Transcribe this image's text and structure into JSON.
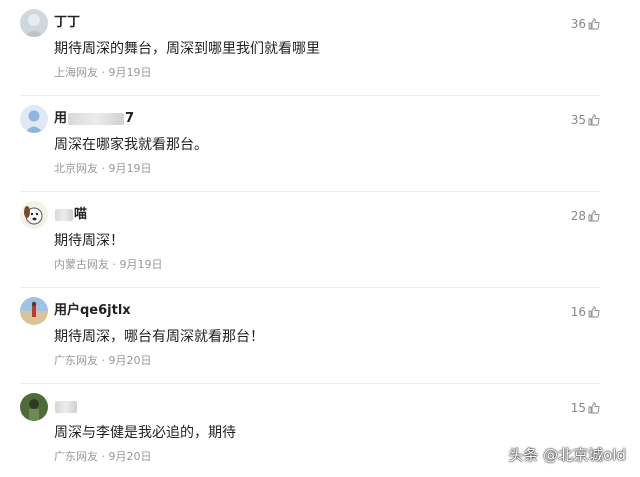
{
  "comments": [
    {
      "username": "丁丁",
      "avatar_icon": "gray-blur-avatar",
      "content": "期待周深的舞台，周深到哪里我们就看哪里",
      "location": "上海网友",
      "date": "9月19日",
      "likes": "36"
    },
    {
      "username_prefix": "用",
      "username_suffix": "7",
      "avatar_icon": "default-user-avatar",
      "content": "周深在哪家我就看那台。",
      "location": "北京网友",
      "date": "9月19日",
      "likes": "35"
    },
    {
      "username_suffix": "喵",
      "avatar_icon": "cartoon-dog-avatar",
      "content": "期待周深！",
      "location": "内蒙古网友",
      "date": "9月19日",
      "likes": "28"
    },
    {
      "username": "用户qe6jtlx",
      "avatar_icon": "beach-photo-avatar",
      "content": "期待周深，哪台有周深就看那台！",
      "location": "广东网友",
      "date": "9月20日",
      "likes": "16"
    },
    {
      "avatar_icon": "green-photo-avatar",
      "content": "周深与李健是我必追的，期待",
      "location": "广东网友",
      "date": "9月20日",
      "likes": "15"
    }
  ],
  "meta_separator": "·",
  "like_icon": "thumbs-up-icon",
  "watermark": "头条 @北京城old",
  "colors": {
    "text": "#222222",
    "meta": "#999999",
    "likes": "#888888",
    "divider": "#ececec"
  }
}
